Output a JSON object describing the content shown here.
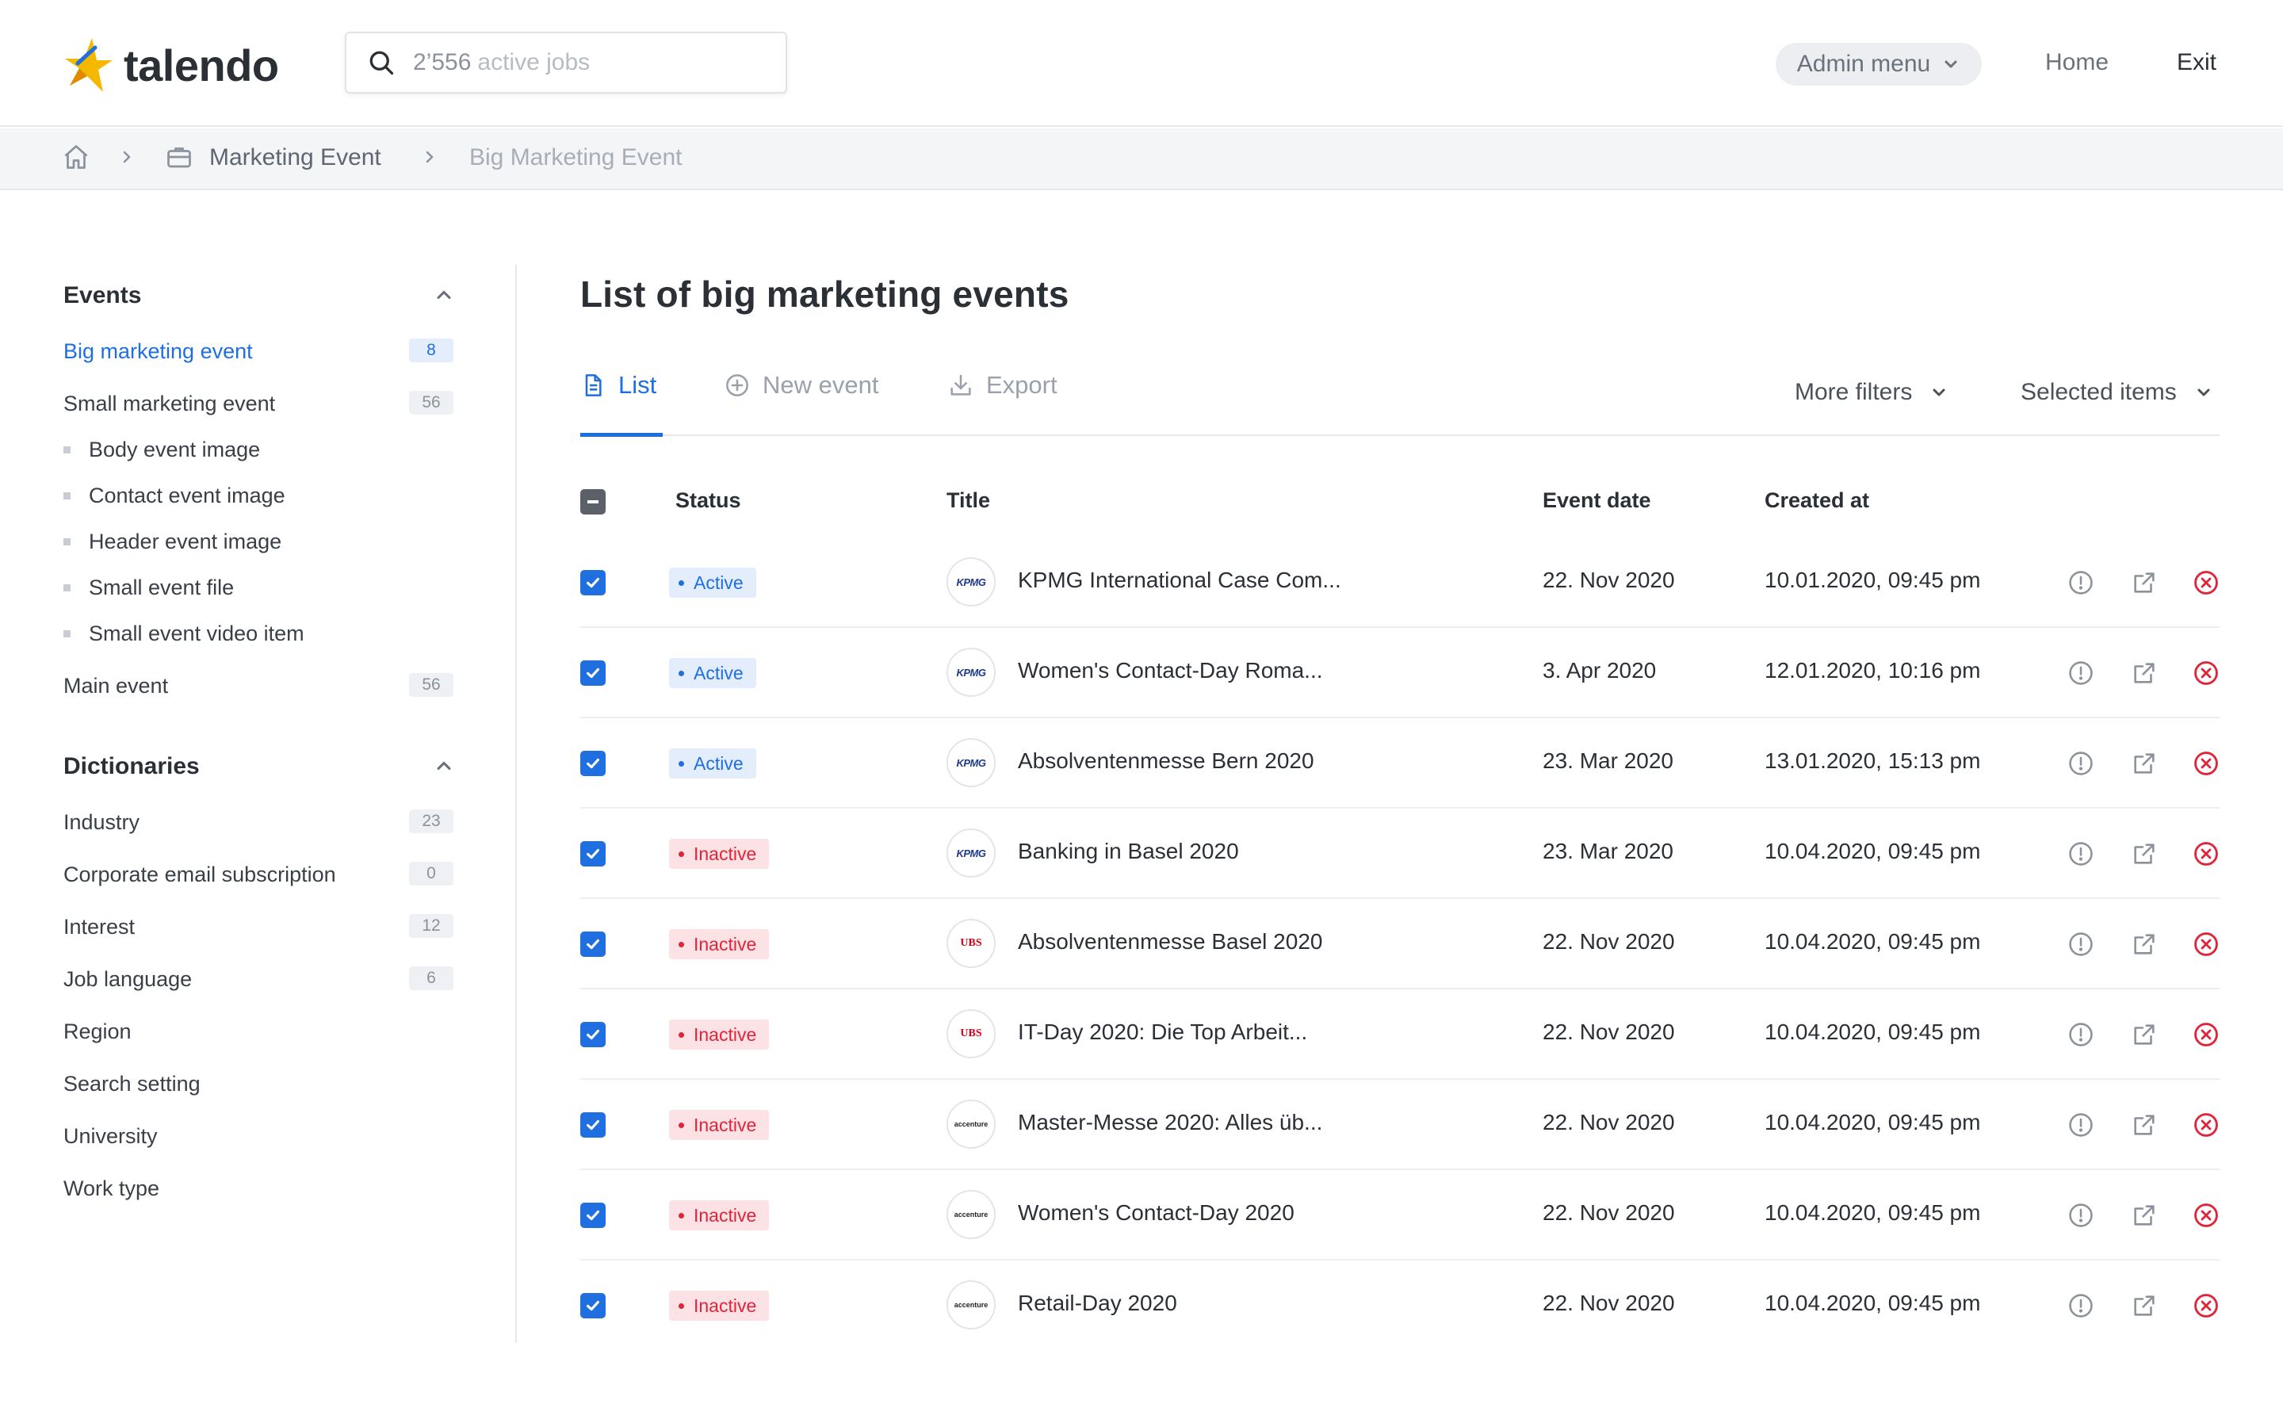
{
  "header": {
    "brand": "talendo",
    "search": {
      "count": "2’556",
      "placeholder": "active jobs"
    },
    "admin_menu": "Admin menu",
    "nav": {
      "home": "Home",
      "exit": "Exit"
    }
  },
  "breadcrumb": {
    "items": [
      "Marketing Event",
      "Big Marketing Event"
    ]
  },
  "sidebar": {
    "events": {
      "title": "Events",
      "items": [
        {
          "label": "Big marketing event",
          "count": "8",
          "active": true
        },
        {
          "label": "Small marketing event",
          "count": "56"
        }
      ],
      "sub_items": [
        "Body event image",
        "Contact event image",
        "Header event image",
        "Small event file",
        "Small event video item"
      ],
      "main_event": {
        "label": "Main event",
        "count": "56"
      }
    },
    "dictionaries": {
      "title": "Dictionaries",
      "items": [
        {
          "label": "Industry",
          "count": "23"
        },
        {
          "label": "Corporate email subscription",
          "count": "0"
        },
        {
          "label": "Interest",
          "count": "12"
        },
        {
          "label": "Job language",
          "count": "6"
        },
        {
          "label": "Region"
        },
        {
          "label": "Search setting"
        },
        {
          "label": "University"
        },
        {
          "label": "Work type"
        }
      ]
    }
  },
  "main": {
    "title": "List of big marketing events",
    "tabs": {
      "list": "List",
      "new_event": "New event",
      "export": "Export"
    },
    "filters": {
      "more": "More filters",
      "selected": "Selected items"
    },
    "table": {
      "headers": {
        "status": "Status",
        "title": "Title",
        "event_date": "Event date",
        "created_at": "Created at"
      },
      "rows": [
        {
          "status": "Active",
          "logo": "KPMG",
          "title": "KPMG International Case Com...",
          "event_date": "22. Nov 2020",
          "created_at": "10.01.2020, 09:45 pm"
        },
        {
          "status": "Active",
          "logo": "KPMG",
          "title": "Women's Contact-Day Roma...",
          "event_date": "3. Apr 2020",
          "created_at": "12.01.2020, 10:16 pm"
        },
        {
          "status": "Active",
          "logo": "KPMG",
          "title": "Absolventenmesse Bern 2020",
          "event_date": "23. Mar 2020",
          "created_at": "13.01.2020, 15:13 pm"
        },
        {
          "status": "Inactive",
          "logo": "KPMG",
          "title": "Banking in Basel 2020",
          "event_date": "23. Mar 2020",
          "created_at": "10.04.2020, 09:45 pm"
        },
        {
          "status": "Inactive",
          "logo": "UBS",
          "title": "Absolventenmesse Basel 2020",
          "event_date": "22. Nov 2020",
          "created_at": "10.04.2020, 09:45 pm"
        },
        {
          "status": "Inactive",
          "logo": "UBS",
          "title": "IT-Day 2020: Die Top Arbeit...",
          "event_date": "22. Nov 2020",
          "created_at": "10.04.2020, 09:45 pm"
        },
        {
          "status": "Inactive",
          "logo": "accenture",
          "title": "Master-Messe 2020: Alles üb...",
          "event_date": "22. Nov 2020",
          "created_at": "10.04.2020, 09:45 pm"
        },
        {
          "status": "Inactive",
          "logo": "accenture",
          "title": "Women's Contact-Day 2020",
          "event_date": "22. Nov 2020",
          "created_at": "10.04.2020, 09:45 pm"
        },
        {
          "status": "Inactive",
          "logo": "accenture",
          "title": "Retail-Day 2020",
          "event_date": "22. Nov 2020",
          "created_at": "10.04.2020, 09:45 pm"
        }
      ]
    }
  },
  "colors": {
    "accent": "#1f6fe0",
    "danger": "#e0243a",
    "brand_star": "#f5b800"
  }
}
